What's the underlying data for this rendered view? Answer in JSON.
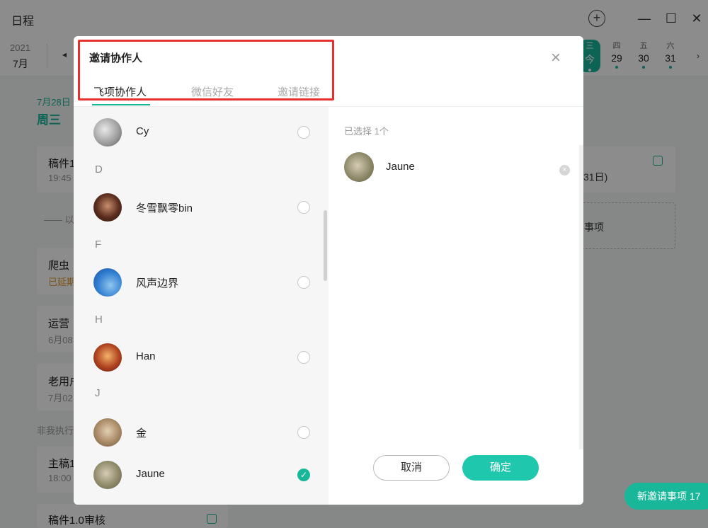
{
  "app": {
    "title": "日程",
    "year": "2021",
    "month": "7月",
    "prev_arrow": "◂",
    "next_arrow": "›",
    "week_days": [
      {
        "wk": "三",
        "dn": "今",
        "today": true
      },
      {
        "wk": "四",
        "dn": "29"
      },
      {
        "wk": "五",
        "dn": "30"
      },
      {
        "wk": "六",
        "dn": "31"
      }
    ],
    "selected_date": "7月28日",
    "selected_weekday": "周三",
    "cards": [
      {
        "title": "稿件1",
        "sub": "19:45"
      },
      {
        "title": "爬虫",
        "sub": "已延期"
      },
      {
        "title": "运营",
        "sub": "6月08"
      },
      {
        "title": "老用户",
        "sub": "7月02"
      },
      {
        "title": "主稿1",
        "sub": "18:00"
      },
      {
        "title": "稿件1.0审核",
        "sub": ""
      }
    ],
    "divider_text": "—— 以",
    "non_executor_label": "非我执行",
    "right_card_sub": "31日)",
    "right_dash_text": "事项",
    "invite_pill": "新邀请事项 17"
  },
  "modal": {
    "title": "邀请协作人",
    "close_icon": "×",
    "tabs": [
      {
        "label": "飞项协作人",
        "active": true
      },
      {
        "label": "微信好友"
      },
      {
        "label": "邀请链接"
      }
    ],
    "contacts": [
      {
        "name": "Cy",
        "checked": false
      },
      {
        "letter": "D"
      },
      {
        "name": "冬雪飘零bin",
        "checked": false
      },
      {
        "letter": "F"
      },
      {
        "name": "风声边界",
        "checked": false
      },
      {
        "letter": "H"
      },
      {
        "name": "Han",
        "checked": false
      },
      {
        "letter": "J"
      },
      {
        "name": "金",
        "checked": false
      },
      {
        "name": "Jaune",
        "checked": true
      }
    ],
    "selected_count_label": "已选择 1个",
    "selected": [
      {
        "name": "Jaune"
      }
    ],
    "cancel_label": "取消",
    "confirm_label": "确定",
    "check_mark": "✓",
    "remove_mark": "×"
  },
  "colors": {
    "accent": "#18b79a",
    "confirm": "#1fc8ad",
    "highlight": "#e53030"
  }
}
